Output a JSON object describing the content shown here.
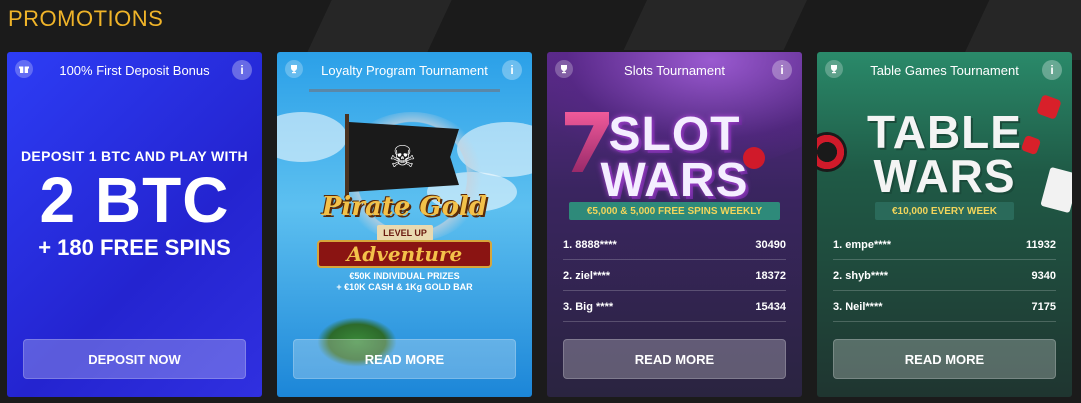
{
  "page": {
    "heading": "PROMOTIONS"
  },
  "colors": {
    "heading": "#f0b429",
    "background": "#1b1b1b"
  },
  "cards": [
    {
      "icon": "gift-icon",
      "title": "100% First Deposit Bonus",
      "info": "i",
      "line1": "DEPOSIT 1 BTC AND PLAY WITH",
      "line2": "2 BTC",
      "line3": "+ 180 FREE SPINS",
      "button": "DEPOSIT NOW"
    },
    {
      "icon": "trophy-icon",
      "title": "Loyalty Program Tournament",
      "info": "i",
      "game_title": "Pirate Gold",
      "level_badge": "LEVEL UP",
      "subtitle": "Adventure",
      "prize1": "€50K INDIVIDUAL PRIZES",
      "prize2": "+ €10K CASH & 1Kg GOLD BAR",
      "button": "READ MORE"
    },
    {
      "icon": "trophy-icon",
      "title": "Slots Tournament",
      "info": "i",
      "banner_line1": "SLOT",
      "banner_line2": "WARS",
      "ribbon": "€5,000 & 5,000 FREE SPINS WEEKLY",
      "leaderboard": [
        {
          "name": "1. 8888****",
          "score": "30490"
        },
        {
          "name": "2. ziel****",
          "score": "18372"
        },
        {
          "name": "3. Big ****",
          "score": "15434"
        }
      ],
      "button": "READ MORE"
    },
    {
      "icon": "trophy-icon",
      "title": "Table Games Tournament",
      "info": "i",
      "banner_line1": "TABLE",
      "banner_line2": "WARS",
      "ribbon": "€10,000 EVERY WEEK",
      "leaderboard": [
        {
          "name": "1. empe****",
          "score": "11932"
        },
        {
          "name": "2. shyb****",
          "score": "9340"
        },
        {
          "name": "3. Neil****",
          "score": "7175"
        }
      ],
      "button": "READ MORE"
    }
  ]
}
